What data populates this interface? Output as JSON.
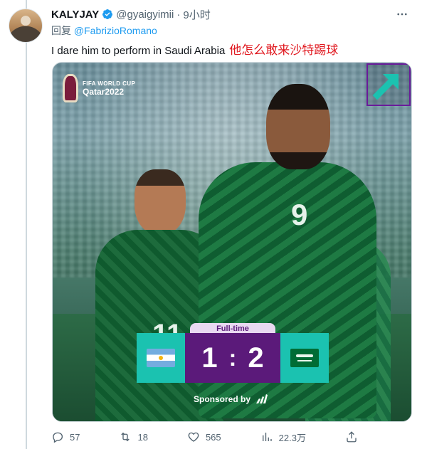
{
  "author": {
    "name": "KALYJAY",
    "handle": "@gyaigyimii",
    "separator": "·",
    "time": "9小时"
  },
  "reply": {
    "prefix": "回复",
    "mention": "@FabrizioRomano"
  },
  "tweet": {
    "text": "I dare him to perform in Saudi Arabia",
    "translation": "他怎么敢来沙特踢球"
  },
  "media": {
    "logo_line1": "FIFA WORLD CUP",
    "logo_line2": "Qatar2022",
    "status_label": "Full-time",
    "score_home": "1",
    "score_sep": ":",
    "score_away": "2",
    "home_flag": "argentina-flag-icon",
    "away_flag": "saudi-arabia-flag-icon",
    "player_number_left": "11",
    "player_number_right": "9",
    "sponsor_text": "Sponsored by",
    "colors": {
      "teal": "#1bc2b0",
      "purple": "#5b1a7a",
      "jersey_green": "#1e7a43"
    }
  },
  "actions": {
    "replies": "57",
    "retweets": "18",
    "likes": "565",
    "views": "22.3万"
  },
  "colors": {
    "link": "#1d9bf0",
    "muted": "#536471",
    "translation": "#e0181f"
  }
}
